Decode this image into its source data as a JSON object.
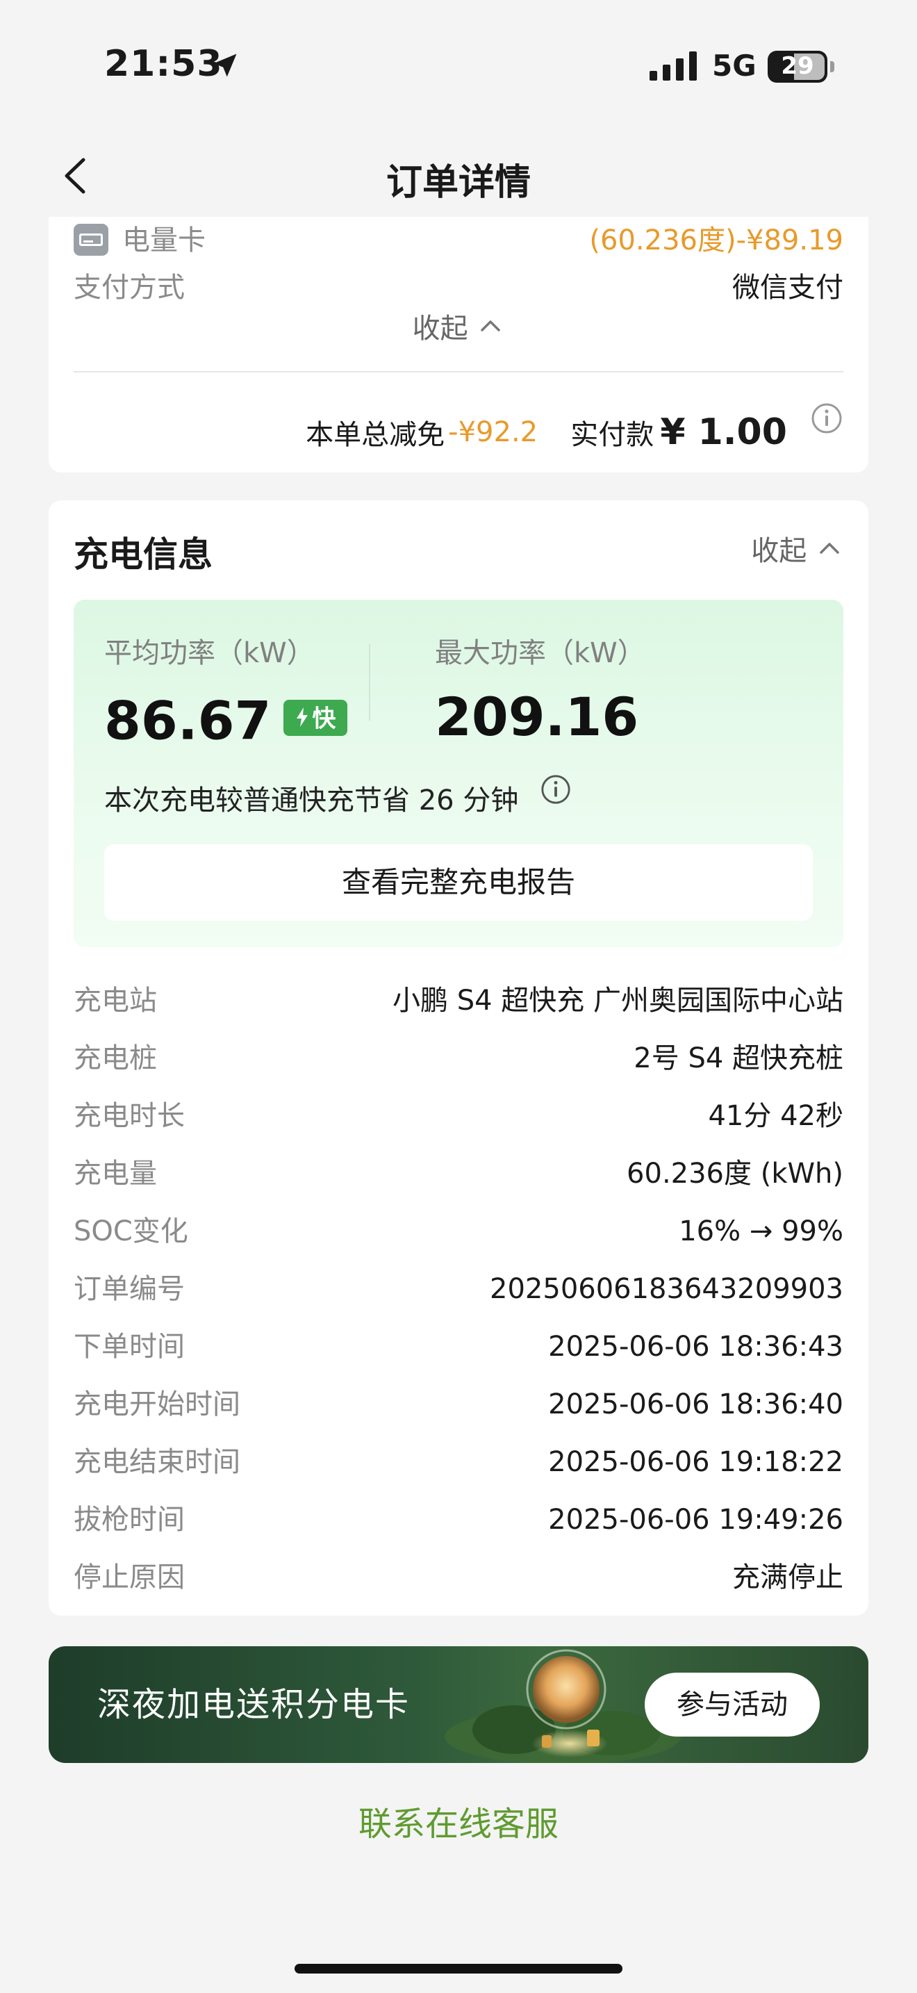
{
  "status_bar": {
    "time": "21:53",
    "network": "5G",
    "battery": "29"
  },
  "nav": {
    "title": "订单详情"
  },
  "payment": {
    "card_label": "电量卡",
    "card_value": "(60.236度)-¥89.19",
    "method_label": "支付方式",
    "method_value": "微信支付",
    "collapse_label": "收起",
    "discount_label": "本单总减免",
    "discount_value": "-¥92.2",
    "paid_label": "实付款",
    "paid_value": "¥ 1.00"
  },
  "charging": {
    "title": "充电信息",
    "collapse_label": "收起",
    "avg_power_label": "平均功率（kW）",
    "avg_power_value": "86.67",
    "fast_badge": "快",
    "max_power_label": "最大功率（kW）",
    "max_power_value": "209.16",
    "save_note": "本次充电较普通快充节省 26 分钟",
    "report_button": "查看完整充电报告",
    "details": [
      {
        "label": "充电站",
        "value": "小鹏 S4 超快充 广州奥园国际中心站"
      },
      {
        "label": "充电桩",
        "value": "2号 S4 超快充桩"
      },
      {
        "label": "充电时长",
        "value": "41分 42秒"
      },
      {
        "label": "充电量",
        "value": "60.236度 (kWh)"
      },
      {
        "label": "SOC变化",
        "value": "16% → 99%"
      },
      {
        "label": "订单编号",
        "value": "20250606183643209903"
      },
      {
        "label": "下单时间",
        "value": "2025-06-06 18:36:43"
      },
      {
        "label": "充电开始时间",
        "value": "2025-06-06 18:36:40"
      },
      {
        "label": "充电结束时间",
        "value": "2025-06-06 19:18:22"
      },
      {
        "label": "拔枪时间",
        "value": "2025-06-06 19:49:26"
      },
      {
        "label": "停止原因",
        "value": "充满停止"
      }
    ]
  },
  "promo": {
    "text": "深夜加电送积分电卡",
    "cta": "参与活动"
  },
  "footer": {
    "service_link": "联系在线客服"
  },
  "colors": {
    "accent_orange": "#e89a2a",
    "badge_green": "#3daa4f",
    "link_green": "#5f9b2f"
  },
  "icons": [
    "location-arrow-icon",
    "signal-icon",
    "battery-icon",
    "back-chevron-icon",
    "card-icon",
    "chevron-up-icon",
    "info-icon",
    "bolt-icon"
  ]
}
